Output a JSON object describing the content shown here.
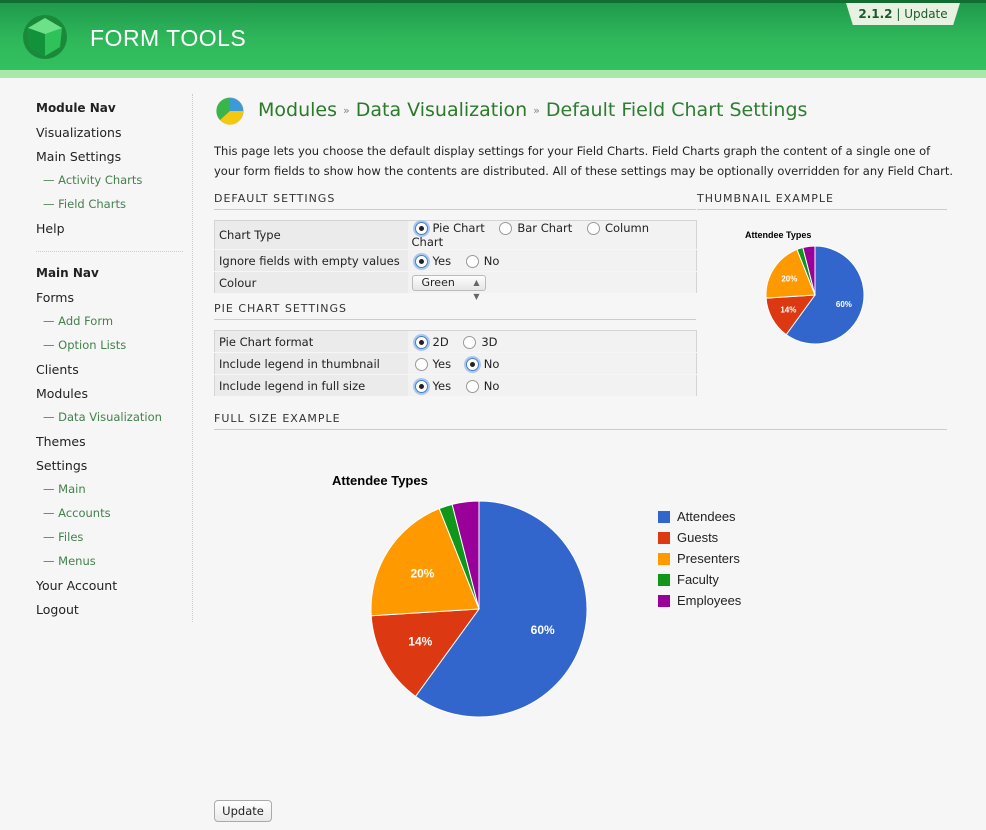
{
  "app": {
    "title": "FORM TOOLS",
    "version": "2.1.2",
    "update_label": "Update"
  },
  "sidebar": {
    "module_nav_title": "Module Nav",
    "module_items": [
      {
        "label": "Visualizations",
        "sub": false
      },
      {
        "label": "Main Settings",
        "sub": false
      },
      {
        "label": "— Activity Charts",
        "sub": true
      },
      {
        "label": "— Field Charts",
        "sub": true
      },
      {
        "label": "Help",
        "sub": false
      }
    ],
    "main_nav_title": "Main Nav",
    "main_items": [
      {
        "label": "Forms",
        "sub": false
      },
      {
        "label": "— Add Form",
        "sub": true
      },
      {
        "label": "— Option Lists",
        "sub": true
      },
      {
        "label": "Clients",
        "sub": false
      },
      {
        "label": "Modules",
        "sub": false
      },
      {
        "label": "— Data Visualization",
        "sub": true
      },
      {
        "label": "Themes",
        "sub": false
      },
      {
        "label": "Settings",
        "sub": false
      },
      {
        "label": "— Main",
        "sub": true
      },
      {
        "label": "— Accounts",
        "sub": true
      },
      {
        "label": "— Files",
        "sub": true
      },
      {
        "label": "— Menus",
        "sub": true
      },
      {
        "label": "Your Account",
        "sub": false
      },
      {
        "label": "Logout",
        "sub": false
      }
    ]
  },
  "breadcrumb": {
    "part1": "Modules",
    "part2": "Data Visualization",
    "current": "Default Field Chart Settings",
    "separator": "»"
  },
  "intro": "This page lets you choose the default display settings for your Field Charts. Field Charts graph the content of a single one of your form fields to show how the contents are distributed. All of these settings may be optionally overridden for any Field Chart.",
  "default_settings": {
    "title": "DEFAULT SETTINGS",
    "chart_type": {
      "label": "Chart Type",
      "options": [
        "Pie Chart",
        "Bar Chart",
        "Column Chart"
      ],
      "selected": "Pie Chart"
    },
    "ignore_empty": {
      "label": "Ignore fields with empty values",
      "options": [
        "Yes",
        "No"
      ],
      "selected": "Yes"
    },
    "colour": {
      "label": "Colour",
      "value": "Green"
    }
  },
  "pie_settings": {
    "title": "PIE CHART SETTINGS",
    "format": {
      "label": "Pie Chart format",
      "options": [
        "2D",
        "3D"
      ],
      "selected": "2D"
    },
    "legend_thumb": {
      "label": "Include legend in thumbnail",
      "options": [
        "Yes",
        "No"
      ],
      "selected": "No"
    },
    "legend_full": {
      "label": "Include legend in full size",
      "options": [
        "Yes",
        "No"
      ],
      "selected": "Yes"
    }
  },
  "thumbnail_example_title": "THUMBNAIL EXAMPLE",
  "full_size_example_title": "FULL SIZE EXAMPLE",
  "update_button": "Update",
  "chart_data": [
    {
      "type": "pie",
      "title": "Attendee Types",
      "categories": [
        "Attendees",
        "Guests",
        "Presenters",
        "Faculty",
        "Employees"
      ],
      "values": [
        60,
        14,
        20,
        2,
        4
      ],
      "labels": [
        "60%",
        "14%",
        "20%",
        "",
        ""
      ],
      "colors": [
        "#3366cc",
        "#dc3912",
        "#ff9900",
        "#109618",
        "#990099"
      ],
      "legend": "none"
    },
    {
      "type": "pie",
      "title": "Attendee Types",
      "categories": [
        "Attendees",
        "Guests",
        "Presenters",
        "Faculty",
        "Employees"
      ],
      "values": [
        60,
        14,
        20,
        2,
        4
      ],
      "labels": [
        "60%",
        "14%",
        "20%",
        "",
        ""
      ],
      "colors": [
        "#3366cc",
        "#dc3912",
        "#ff9900",
        "#109618",
        "#990099"
      ],
      "legend": "right"
    }
  ]
}
